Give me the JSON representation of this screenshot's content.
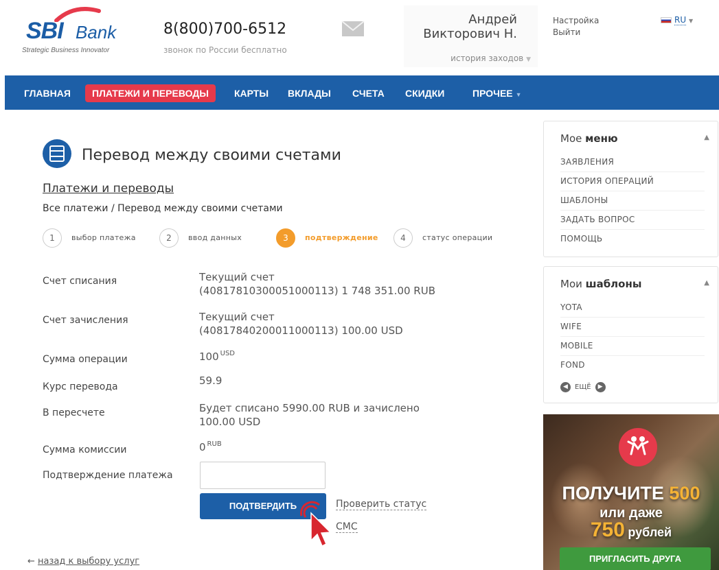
{
  "brand": {
    "name": "SBI",
    "suffix": "Bank",
    "tagline": "Strategic Business Innovator",
    "colors": {
      "primary": "#1d5fa7",
      "active_nav": "#e63a4b",
      "step_current": "#f39c2b",
      "promo_button": "#3f9a3e"
    }
  },
  "header": {
    "phone": "8(800)700-6512",
    "phone_note": "звонок по России бесплатно",
    "mail_icon": "envelope-icon",
    "user": {
      "name": "Андрей\nВикторович Н.",
      "history": "история заходов"
    },
    "links": {
      "settings": "Настройка",
      "logout": "Выйти"
    },
    "language": "RU"
  },
  "nav": {
    "items": [
      {
        "label": "ГЛАВНАЯ"
      },
      {
        "label": "ПЛАТЕЖИ И ПЕРЕВОДЫ",
        "active": true
      },
      {
        "label": "КАРТЫ"
      },
      {
        "label": "ВКЛАДЫ"
      },
      {
        "label": "СЧЕТА"
      },
      {
        "label": "СКИДКИ"
      },
      {
        "label": "ПРОЧЕЕ"
      }
    ]
  },
  "page": {
    "icon": "transfer-icon",
    "title": "Перевод между своими счетами",
    "breadcrumb_link": "Платежи и переводы",
    "breadcrumb_path": "Все платежи / Перевод между своими счетами"
  },
  "steps": [
    {
      "num": "1",
      "label": "выбор платежа"
    },
    {
      "num": "2",
      "label": "ввод данных"
    },
    {
      "num": "3",
      "label": "подтверждение",
      "current": true
    },
    {
      "num": "4",
      "label": "статус операции"
    }
  ],
  "form": {
    "fields": [
      {
        "label": "Счет списания",
        "value": "Текущий счет\n(40817810300051000113) 1 748 351.00 RUB"
      },
      {
        "label": "Счет зачисления",
        "value": "Текущий счет\n(40817840200011000113) 100.00 USD"
      },
      {
        "label": "Сумма операции",
        "value": "100",
        "unit": "USD"
      },
      {
        "label": "Курс перевода",
        "value": "59.9"
      },
      {
        "label": "В пересчете",
        "value": "Будет списано 5990.00 RUB и зачислено\n100.00 USD"
      },
      {
        "label": "Сумма комиссии",
        "value": "0",
        "unit": "RUB"
      }
    ],
    "confirmation_label": "Подтверждение платежа",
    "confirmation_value": "",
    "confirm_button": "ПОДТВЕРДИТЬ",
    "check_status": "Проверить статус",
    "sms": "СМС",
    "back": "назад к выбору услуг"
  },
  "sidebar": {
    "menu": {
      "title_prefix": "Мое",
      "title_bold": "меню",
      "items": [
        "ЗАЯВЛЕНИЯ",
        "ИСТОРИЯ ОПЕРАЦИЙ",
        "ШАБЛОНЫ",
        "ЗАДАТЬ ВОПРОС",
        "ПОМОЩЬ"
      ]
    },
    "templates": {
      "title_prefix": "Мои",
      "title_bold": "шаблоны",
      "items": [
        "YOTA",
        "WIFE",
        "MOBILE",
        "FOND"
      ],
      "more": "ЕЩЁ"
    }
  },
  "promo": {
    "line1_a": "ПОЛУЧИТЕ",
    "line1_b": "500",
    "line2": "или даже",
    "line3_a": "750",
    "line3_b": "рублей",
    "button": "ПРИГЛАСИТЬ ДРУГА"
  }
}
